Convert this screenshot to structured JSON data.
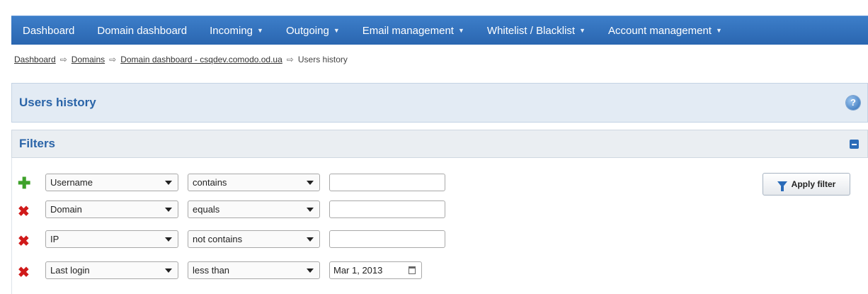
{
  "nav": {
    "items": [
      {
        "label": "Dashboard",
        "dropdown": false
      },
      {
        "label": "Domain dashboard",
        "dropdown": false
      },
      {
        "label": "Incoming",
        "dropdown": true
      },
      {
        "label": "Outgoing",
        "dropdown": true
      },
      {
        "label": "Email management",
        "dropdown": true
      },
      {
        "label": "Whitelist / Blacklist",
        "dropdown": true
      },
      {
        "label": "Account management",
        "dropdown": true
      }
    ],
    "caret": "▼"
  },
  "breadcrumb": {
    "items": [
      "Dashboard",
      "Domains",
      "Domain dashboard - csqdev.comodo.od.ua"
    ],
    "current": "Users history",
    "separator": "⇨"
  },
  "page": {
    "title": "Users history",
    "help_icon": "?"
  },
  "filters": {
    "title": "Filters",
    "apply_label": "Apply filter",
    "rows": [
      {
        "field": "Username",
        "operator": "contains",
        "value": "",
        "icon": "plus-icon"
      },
      {
        "field": "Domain",
        "operator": "equals",
        "value": "",
        "icon": "remove-icon"
      },
      {
        "field": "IP",
        "operator": "not contains",
        "value": "",
        "icon": "remove-icon"
      },
      {
        "field": "Last login",
        "operator": "less than",
        "value": "Mar 1, 2013",
        "icon": "remove-icon"
      }
    ]
  },
  "colors": {
    "nav_bg": "#2f6fbd",
    "title_text": "#2a64a8",
    "add": "#3ea12a",
    "remove": "#d01a1a"
  }
}
